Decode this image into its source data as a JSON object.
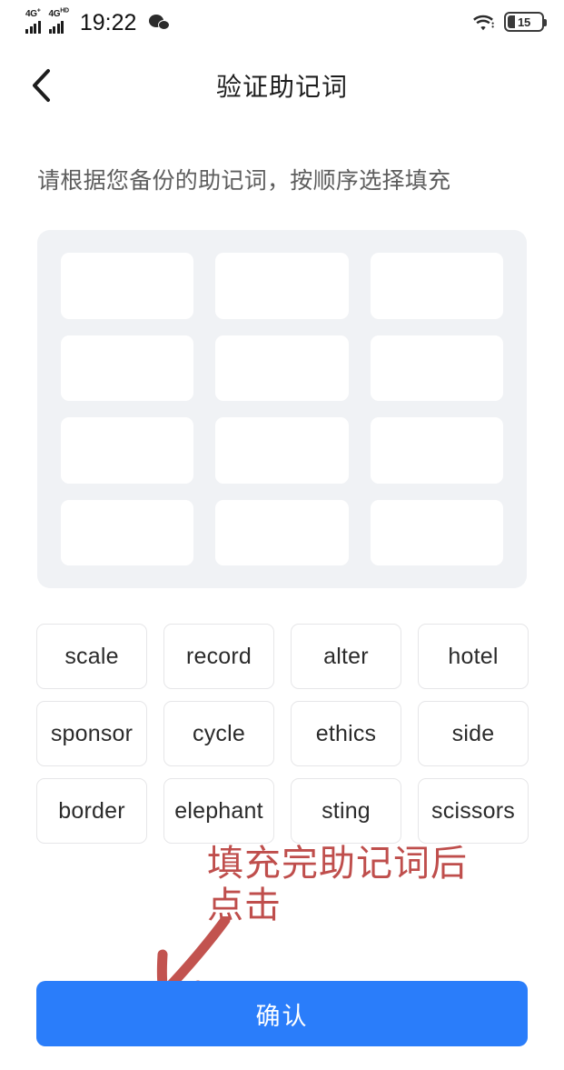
{
  "status_bar": {
    "signal_1_label": "4G",
    "signal_1_sup": "+",
    "signal_2_label": "4G",
    "signal_2_sup": "HD",
    "time": "19:22",
    "wechat_icon": "wechat-icon",
    "wifi_icon": "wifi-icon",
    "battery_level": "15"
  },
  "nav": {
    "back_icon": "chevron-left-icon",
    "title": "验证助记词"
  },
  "instruction": "请根据您备份的助记词，按顺序选择填充",
  "slots": {
    "count": 12,
    "values": [
      "",
      "",
      "",
      "",
      "",
      "",
      "",
      "",
      "",
      "",
      "",
      ""
    ]
  },
  "word_rows": [
    [
      "scale",
      "record",
      "alter",
      "hotel"
    ],
    [
      "sponsor",
      "cycle",
      "ethics",
      "side"
    ],
    [
      "border",
      "elephant",
      "sting",
      "scissors"
    ]
  ],
  "annotation": {
    "text": "填充完助记词后\n点击",
    "color": "#bf4e4c",
    "arrow_icon": "hand-drawn-arrow-icon"
  },
  "confirm": {
    "label": "确认",
    "color": "#2a7dfa"
  }
}
